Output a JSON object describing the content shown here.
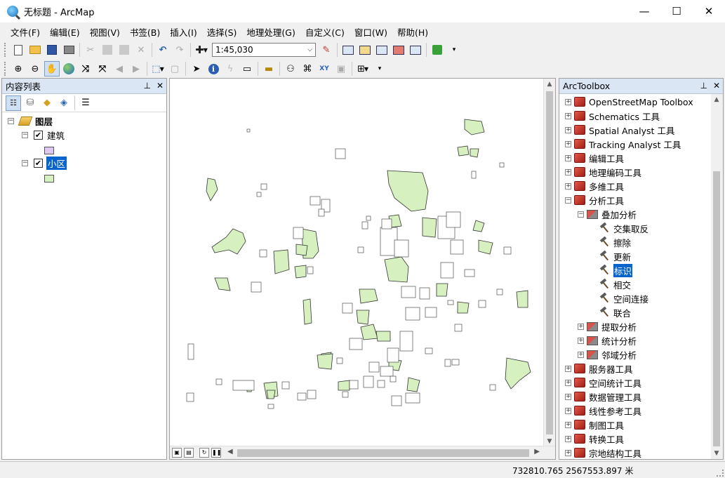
{
  "window": {
    "title": "无标题 - ArcMap",
    "minimize": "—",
    "maximize": "☐",
    "close": "✕"
  },
  "menu": [
    "文件(F)",
    "编辑(E)",
    "视图(V)",
    "书签(B)",
    "插入(I)",
    "选择(S)",
    "地理处理(G)",
    "自定义(C)",
    "窗口(W)",
    "帮助(H)"
  ],
  "toolbar": {
    "scale": "1:45,030"
  },
  "toc": {
    "title": "内容列表",
    "pin": "⊥",
    "close": "✕",
    "root": "图层",
    "layers": [
      {
        "name": "建筑",
        "checked": "✔",
        "color": "#dcc8f0"
      },
      {
        "name": "小区",
        "checked": "✔",
        "color": "#d6f0c0"
      }
    ]
  },
  "toolbox": {
    "title": "ArcToolbox",
    "pin": "⊥",
    "close": "✕",
    "items": [
      {
        "label": "OpenStreetMap Toolbox",
        "level": 0,
        "type": "toolbox",
        "expander": "+"
      },
      {
        "label": "Schematics 工具",
        "level": 0,
        "type": "toolbox",
        "expander": "+"
      },
      {
        "label": "Spatial Analyst 工具",
        "level": 0,
        "type": "toolbox",
        "expander": "+"
      },
      {
        "label": "Tracking Analyst 工具",
        "level": 0,
        "type": "toolbox",
        "expander": "+"
      },
      {
        "label": "编辑工具",
        "level": 0,
        "type": "toolbox",
        "expander": "+"
      },
      {
        "label": "地理编码工具",
        "level": 0,
        "type": "toolbox",
        "expander": "+"
      },
      {
        "label": "多维工具",
        "level": 0,
        "type": "toolbox",
        "expander": "+"
      },
      {
        "label": "分析工具",
        "level": 0,
        "type": "toolbox",
        "expander": "−"
      },
      {
        "label": "叠加分析",
        "level": 1,
        "type": "toolset",
        "expander": "−"
      },
      {
        "label": "交集取反",
        "level": 2,
        "type": "tool"
      },
      {
        "label": "擦除",
        "level": 2,
        "type": "tool"
      },
      {
        "label": "更新",
        "level": 2,
        "type": "tool"
      },
      {
        "label": "标识",
        "level": 2,
        "type": "tool",
        "selected": true
      },
      {
        "label": "相交",
        "level": 2,
        "type": "tool"
      },
      {
        "label": "空间连接",
        "level": 2,
        "type": "tool"
      },
      {
        "label": "联合",
        "level": 2,
        "type": "tool"
      },
      {
        "label": "提取分析",
        "level": 1,
        "type": "toolset",
        "expander": "+"
      },
      {
        "label": "统计分析",
        "level": 1,
        "type": "toolset",
        "expander": "+"
      },
      {
        "label": "邻域分析",
        "level": 1,
        "type": "toolset",
        "expander": "+"
      },
      {
        "label": "服务器工具",
        "level": 0,
        "type": "toolbox",
        "expander": "+"
      },
      {
        "label": "空间统计工具",
        "level": 0,
        "type": "toolbox",
        "expander": "+"
      },
      {
        "label": "数据管理工具",
        "level": 0,
        "type": "toolbox",
        "expander": "+"
      },
      {
        "label": "线性参考工具",
        "level": 0,
        "type": "toolbox",
        "expander": "+"
      },
      {
        "label": "制图工具",
        "level": 0,
        "type": "toolbox",
        "expander": "+"
      },
      {
        "label": "转换工具",
        "level": 0,
        "type": "toolbox",
        "expander": "+"
      },
      {
        "label": "宗地结构工具",
        "level": 0,
        "type": "toolbox",
        "expander": "+"
      }
    ]
  },
  "status": {
    "coords": "732810.765  2567553.897 米"
  },
  "colors": {
    "building": "#dcc8f0",
    "district": "#d6f0c0",
    "selection": "#0a64d0",
    "panel_header": "#dbe6f4"
  }
}
